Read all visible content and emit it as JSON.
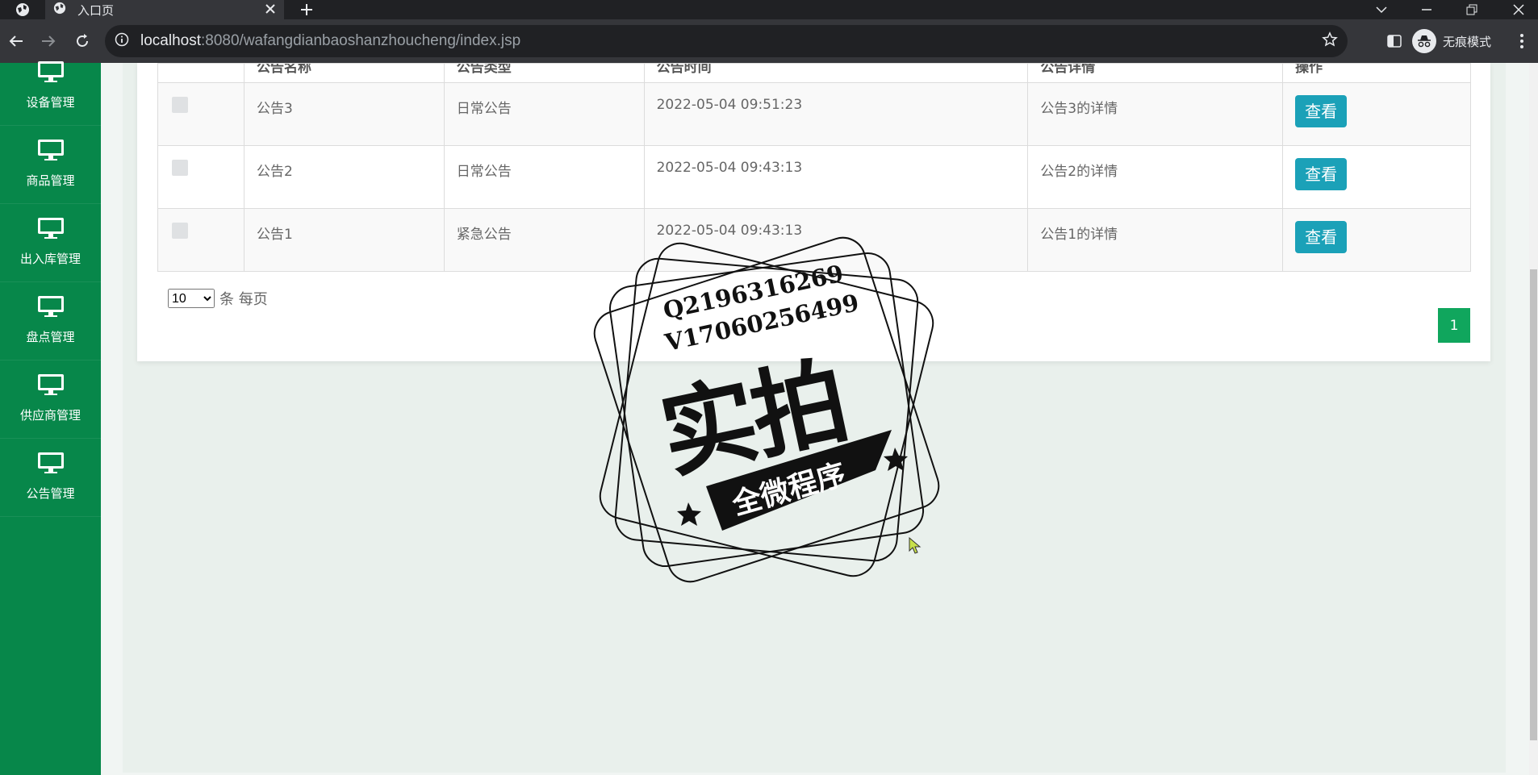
{
  "browser": {
    "tab_title": "入口页",
    "url_host": "localhost",
    "url_rest": ":8080/wafangdianbaoshanzhoucheng/index.jsp",
    "incognito_label": "无痕模式"
  },
  "sidebar": {
    "items": [
      {
        "label": "设备管理"
      },
      {
        "label": "商品管理"
      },
      {
        "label": "出入库管理"
      },
      {
        "label": "盘点管理"
      },
      {
        "label": "供应商管理"
      },
      {
        "label": "公告管理"
      }
    ]
  },
  "table": {
    "columns": [
      "",
      "公告名称",
      "公告类型",
      "公告时间",
      "公告详情",
      "操作"
    ],
    "rows": [
      {
        "name": "公告3",
        "type": "日常公告",
        "time": "2022-05-04 09:51:23",
        "detail": "公告3的详情",
        "action": "查看"
      },
      {
        "name": "公告2",
        "type": "日常公告",
        "time": "2022-05-04 09:43:13",
        "detail": "公告2的详情",
        "action": "查看"
      },
      {
        "name": "公告1",
        "type": "紧急公告",
        "time": "2022-05-04 09:43:13",
        "detail": "公告1的详情",
        "action": "查看"
      }
    ]
  },
  "pagination": {
    "page_size": "10",
    "page_size_suffix": "条 每页",
    "current_page": "1"
  },
  "watermark": {
    "line1": "Q2196316269",
    "line2": "V17060256499",
    "main": "实拍",
    "banner": "全微程序"
  },
  "colors": {
    "sidebar": "#07874a",
    "view_button": "#1ba1b8",
    "page_active": "#10a65d"
  }
}
